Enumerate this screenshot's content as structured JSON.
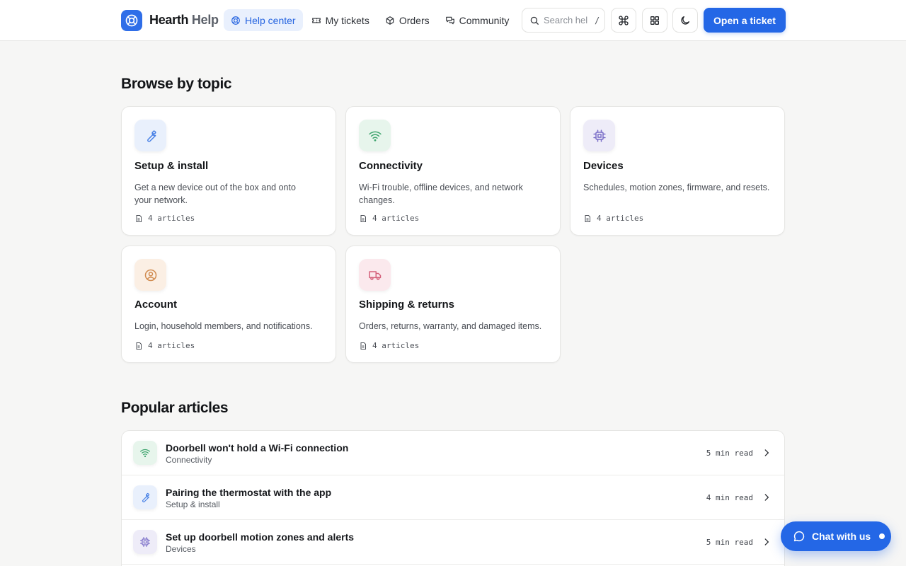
{
  "brand": {
    "name_primary": "Hearth",
    "name_secondary": " Help"
  },
  "nav": [
    {
      "label": "Help center",
      "icon": "lifebuoy-icon",
      "active": true
    },
    {
      "label": "My tickets",
      "icon": "ticket-icon",
      "active": false
    },
    {
      "label": "Orders",
      "icon": "package-icon",
      "active": false
    },
    {
      "label": "Community",
      "icon": "chat-bubbles-icon",
      "active": false
    }
  ],
  "search": {
    "placeholder": "Search help",
    "shortcut": "/"
  },
  "header_icons": [
    "command-icon",
    "grid-icon",
    "moon-icon"
  ],
  "header_cta": "Open a ticket",
  "browse": {
    "title": "Browse by topic",
    "topics": [
      {
        "title": "Setup & install",
        "desc": "Get a new device out of the box and onto your network.",
        "count": "4 articles",
        "icon": "wrench-icon",
        "color": "#4a82e6",
        "bg": "#e9f0fc"
      },
      {
        "title": "Connectivity",
        "desc": "Wi-Fi trouble, offline devices, and network changes.",
        "count": "4 articles",
        "icon": "wifi-icon",
        "color": "#3fa56e",
        "bg": "#e7f5ec"
      },
      {
        "title": "Devices",
        "desc": "Schedules, motion zones, firmware, and resets.",
        "count": "4 articles",
        "icon": "chip-icon",
        "color": "#7b6fc8",
        "bg": "#eeecf8"
      },
      {
        "title": "Account",
        "desc": "Login, household members, and notifications.",
        "count": "4 articles",
        "icon": "user-circle-icon",
        "color": "#d18b4f",
        "bg": "#fbefe4"
      },
      {
        "title": "Shipping & returns",
        "desc": "Orders, returns, warranty, and damaged items.",
        "count": "4 articles",
        "icon": "truck-icon",
        "color": "#d4607a",
        "bg": "#fbe9ed"
      }
    ]
  },
  "popular": {
    "title": "Popular articles",
    "articles": [
      {
        "title": "Doorbell won't hold a Wi-Fi connection",
        "category": "Connectivity",
        "read": "5 min read",
        "icon": "wifi-icon"
      },
      {
        "title": "Pairing the thermostat with the app",
        "category": "Setup & install",
        "read": "4 min read",
        "icon": "wrench-icon"
      },
      {
        "title": "Set up doorbell motion zones and alerts",
        "category": "Devices",
        "read": "5 min read",
        "icon": "chip-icon"
      }
    ]
  },
  "chat": {
    "label": "Chat with us"
  },
  "colors": {
    "accent": "#2467e6",
    "background": "#f6f6f5",
    "active_nav_bg": "#e9f0fd"
  }
}
